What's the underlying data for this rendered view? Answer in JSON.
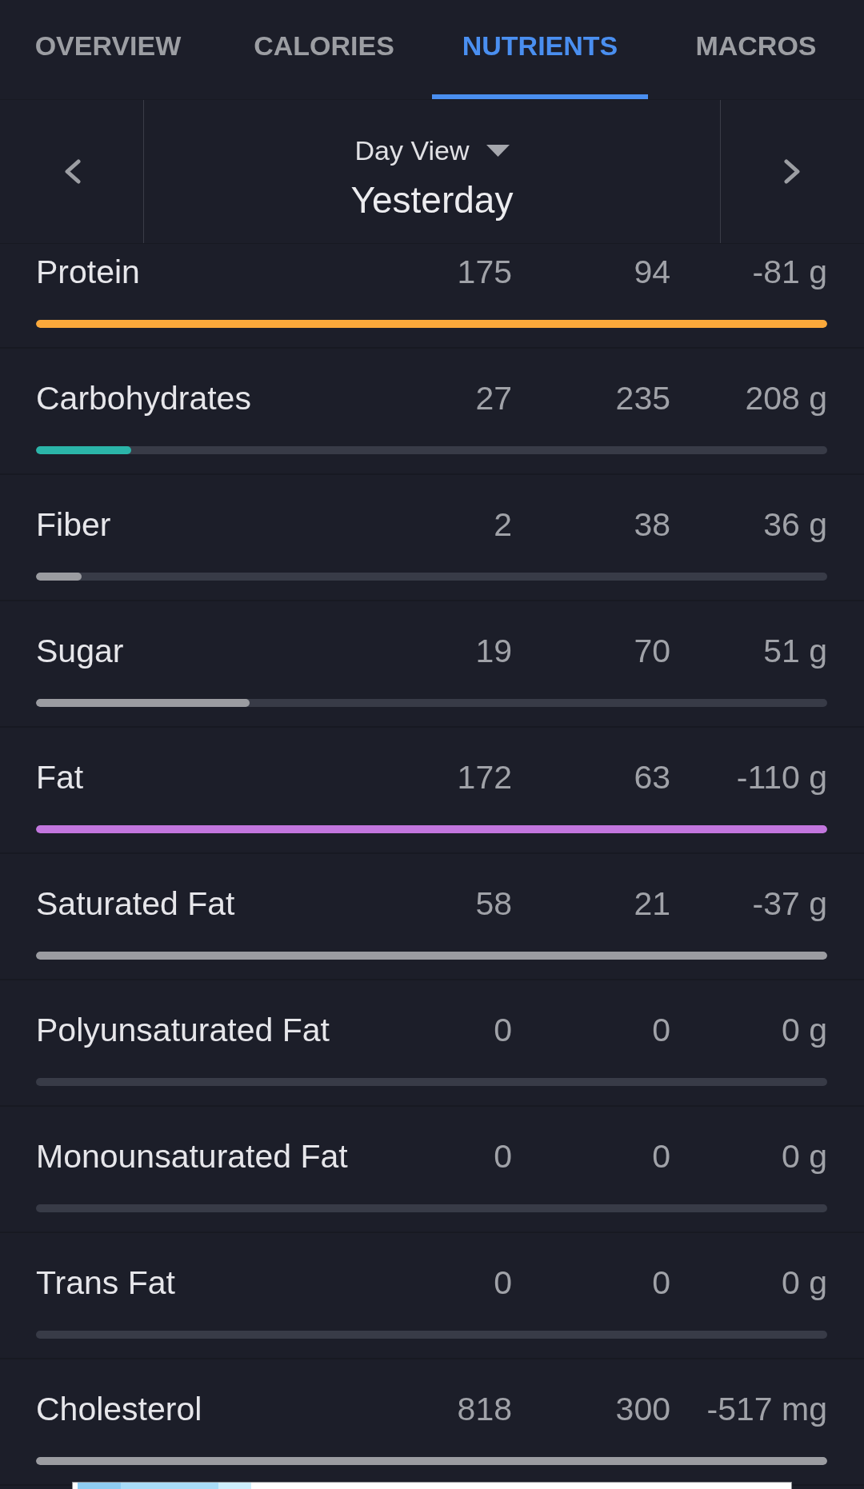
{
  "tabs": [
    {
      "label": "OVERVIEW",
      "selected": false
    },
    {
      "label": "CALORIES",
      "selected": false
    },
    {
      "label": "NUTRIENTS",
      "selected": true
    },
    {
      "label": "MACROS",
      "selected": false
    }
  ],
  "date_nav": {
    "view": "Day View",
    "date": "Yesterday"
  },
  "rows": [
    {
      "name": "Protein",
      "values": [
        "175",
        "94",
        "-81 g"
      ],
      "level": 1,
      "color": "#fba93b"
    },
    {
      "name": "Carbohydrates",
      "values": [
        "27",
        "235",
        "208 g"
      ],
      "level": 0.12,
      "color": "#2bb5a9"
    },
    {
      "name": "Fiber",
      "values": [
        "2",
        "38",
        "36 g"
      ],
      "level": 0.058,
      "color": "#9b9ca1"
    },
    {
      "name": "Sugar",
      "values": [
        "19",
        "70",
        "51 g"
      ],
      "level": 0.27,
      "color": "#9b9ca1"
    },
    {
      "name": "Fat",
      "values": [
        "172",
        "63",
        "-110 g"
      ],
      "level": 1,
      "color": "#c276de"
    },
    {
      "name": "Saturated Fat",
      "values": [
        "58",
        "21",
        "-37 g"
      ],
      "level": 1,
      "color": "#9b9ca1"
    },
    {
      "name": "Polyunsaturated Fat",
      "values": [
        "0",
        "0",
        "0 g"
      ]
    },
    {
      "name": "Monounsaturated Fat",
      "values": [
        "0",
        "0",
        "0 g"
      ]
    },
    {
      "name": "Trans Fat",
      "values": [
        "0",
        "0",
        "0 g"
      ]
    },
    {
      "name": "Cholesterol",
      "values": [
        "818",
        "300",
        "-517 mg"
      ],
      "level": 1,
      "color": "#9b9ca1"
    }
  ]
}
